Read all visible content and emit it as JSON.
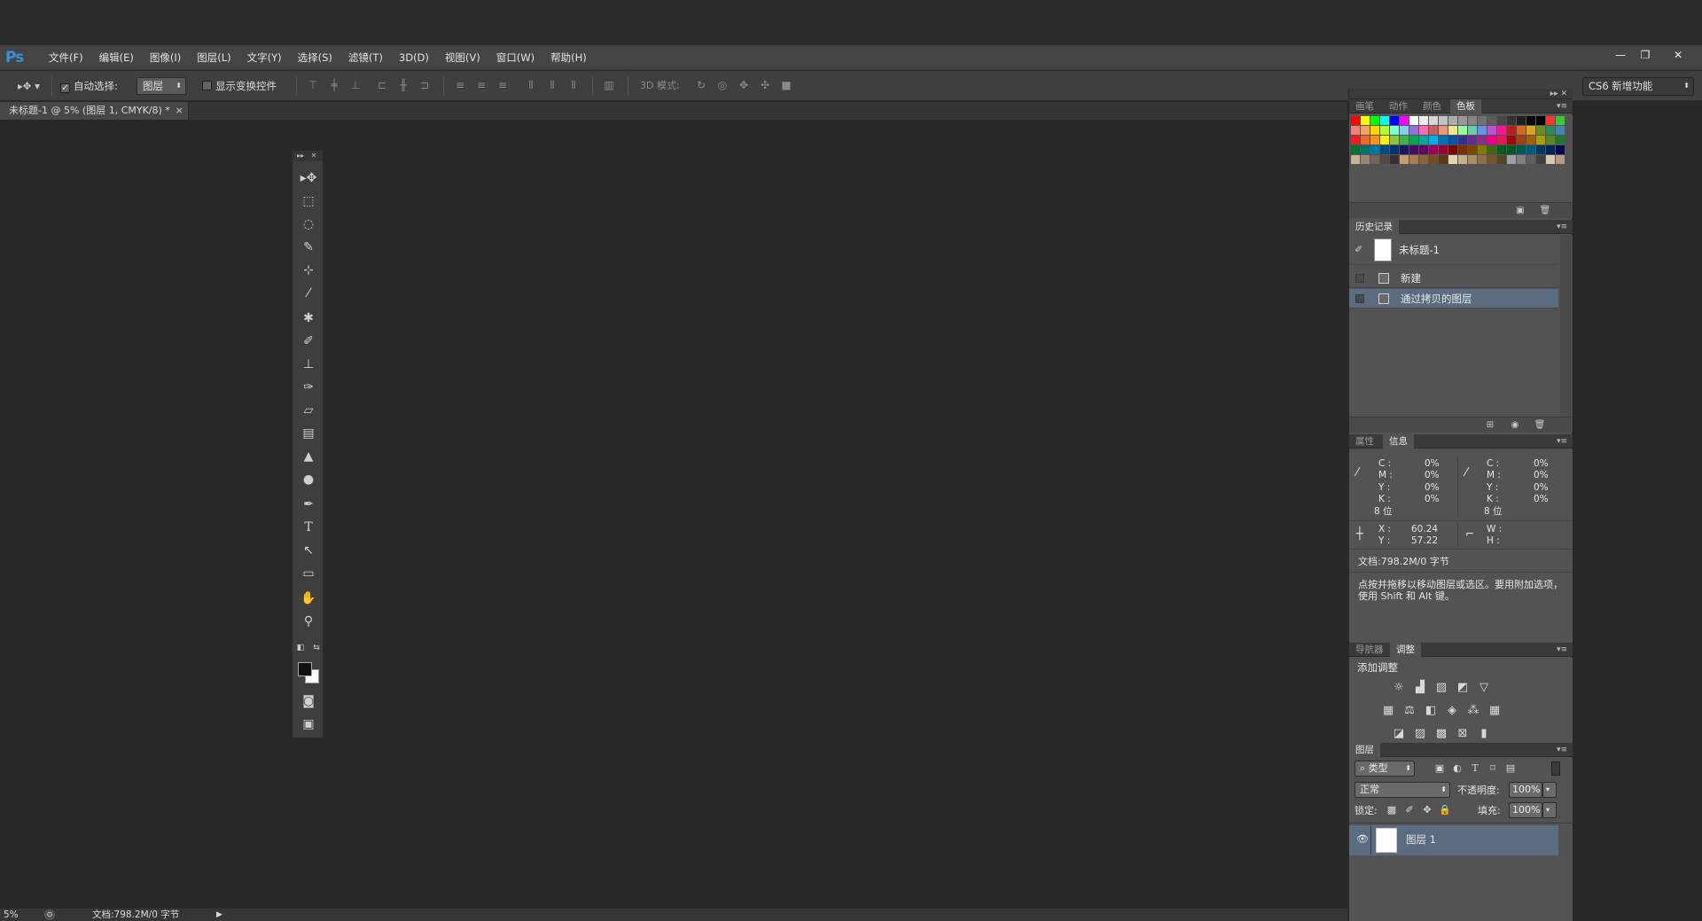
{
  "app": {
    "logo": "Ps"
  },
  "menu": [
    "文件(F)",
    "编辑(E)",
    "图像(I)",
    "图层(L)",
    "文字(Y)",
    "选择(S)",
    "滤镜(T)",
    "3D(D)",
    "视图(V)",
    "窗口(W)",
    "帮助(H)"
  ],
  "window_controls": {
    "minimize": "—",
    "restore": "❐",
    "close": "✕"
  },
  "options": {
    "auto_select_label": "自动选择:",
    "auto_select_checked": true,
    "auto_select_target": "图层",
    "show_transform_label": "显示变换控件",
    "mode_3d_label": "3D 模式:"
  },
  "workspace": "CS6 新增功能",
  "document_tab": {
    "title": "未标题-1 @ 5% (图层 1, CMYK/8) *",
    "close": "×"
  },
  "panels": {
    "swatches": {
      "tabs": [
        "画笔",
        "动作",
        "颜色",
        "色板"
      ],
      "active": 3
    },
    "history": {
      "tab": "历史记录",
      "snapshot": "未标题-1",
      "items": [
        "新建",
        "通过拷贝的图层"
      ]
    },
    "info": {
      "tabs": [
        "属性",
        "信息"
      ],
      "active": 1,
      "left": {
        "C": "0%",
        "M": "0%",
        "Y": "0%",
        "K": "0%",
        "bits": "8 位"
      },
      "right": {
        "C": "0%",
        "M": "0%",
        "Y": "0%",
        "K": "0%",
        "bits": "8 位"
      },
      "x": "60.24",
      "y": "57.22",
      "w": "",
      "h": "",
      "doc": "文档:798.2M/0 字节",
      "hint": "点按并拖移以移动图层或选区。要用附加选项，使用 Shift 和 Alt 键。"
    },
    "adjustments": {
      "tabs": [
        "导航器",
        "调整"
      ],
      "active": 1,
      "title": "添加调整"
    },
    "layers": {
      "tab": "图层",
      "filter": "类型",
      "blend": "正常",
      "opacity_label": "不透明度:",
      "opacity": "100%",
      "lock_label": "锁定:",
      "fill_label": "填充:",
      "fill": "100%",
      "layer_name": "图层 1"
    }
  },
  "status": {
    "zoom": "5%",
    "doc": "文档:798.2M/0 字节"
  },
  "colors": {
    "accent": "#3a8fd8",
    "selected_row": "#5b6b80"
  }
}
